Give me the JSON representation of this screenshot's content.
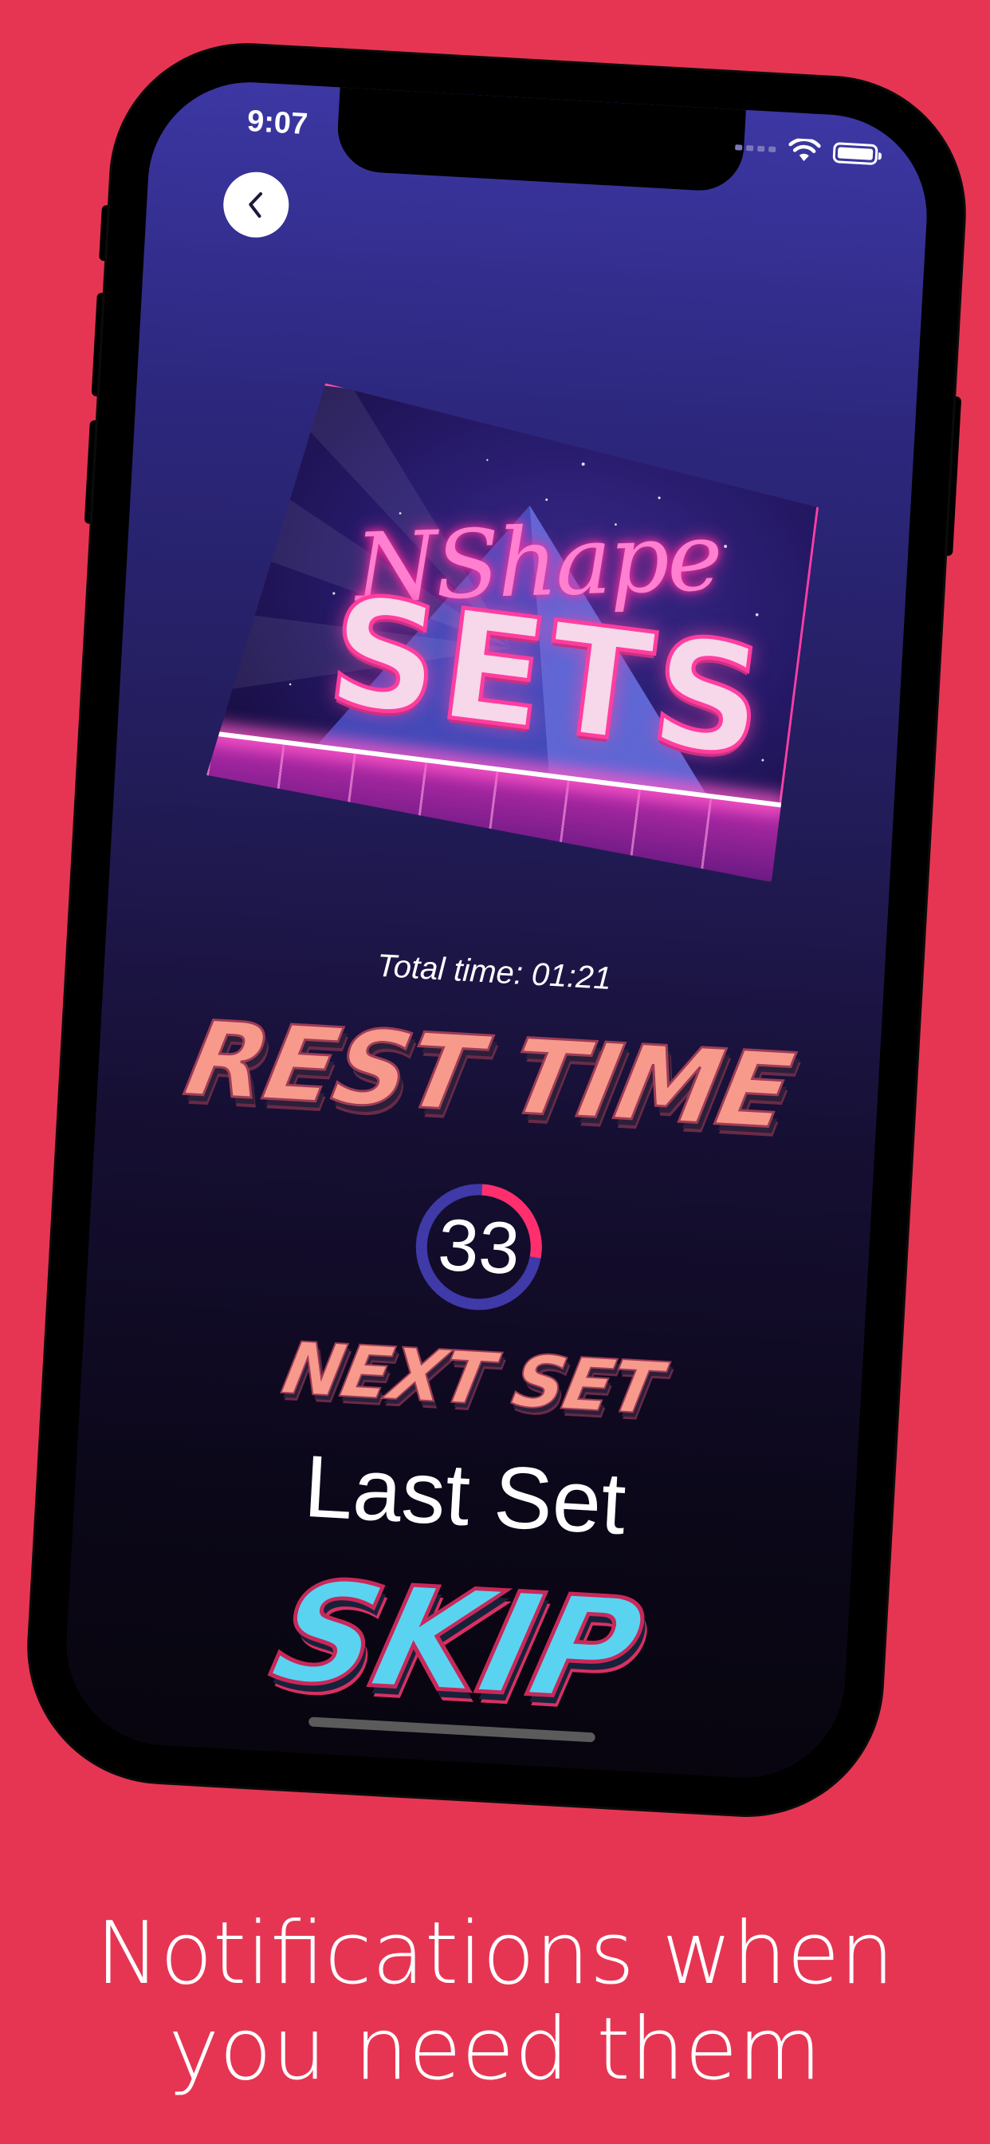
{
  "status_bar": {
    "time": "9:07"
  },
  "logo": {
    "script_text": "NShape",
    "title_text": "SETS"
  },
  "workout": {
    "total_time": "Total time: 01:21",
    "rest_heading": "Rest Time",
    "rest_seconds_remaining": "33",
    "rest_progress_fraction": 0.27,
    "next_set_heading": "Next Set",
    "next_set_value": "Last Set",
    "skip_label": "Skip"
  },
  "caption": {
    "line1": "Notifications when",
    "line2": "you need them"
  },
  "colors": {
    "background": "#e63552",
    "accent": "#ff2f6e",
    "rest_text": "#f79a8c",
    "skip_text": "#5ad3f1"
  }
}
